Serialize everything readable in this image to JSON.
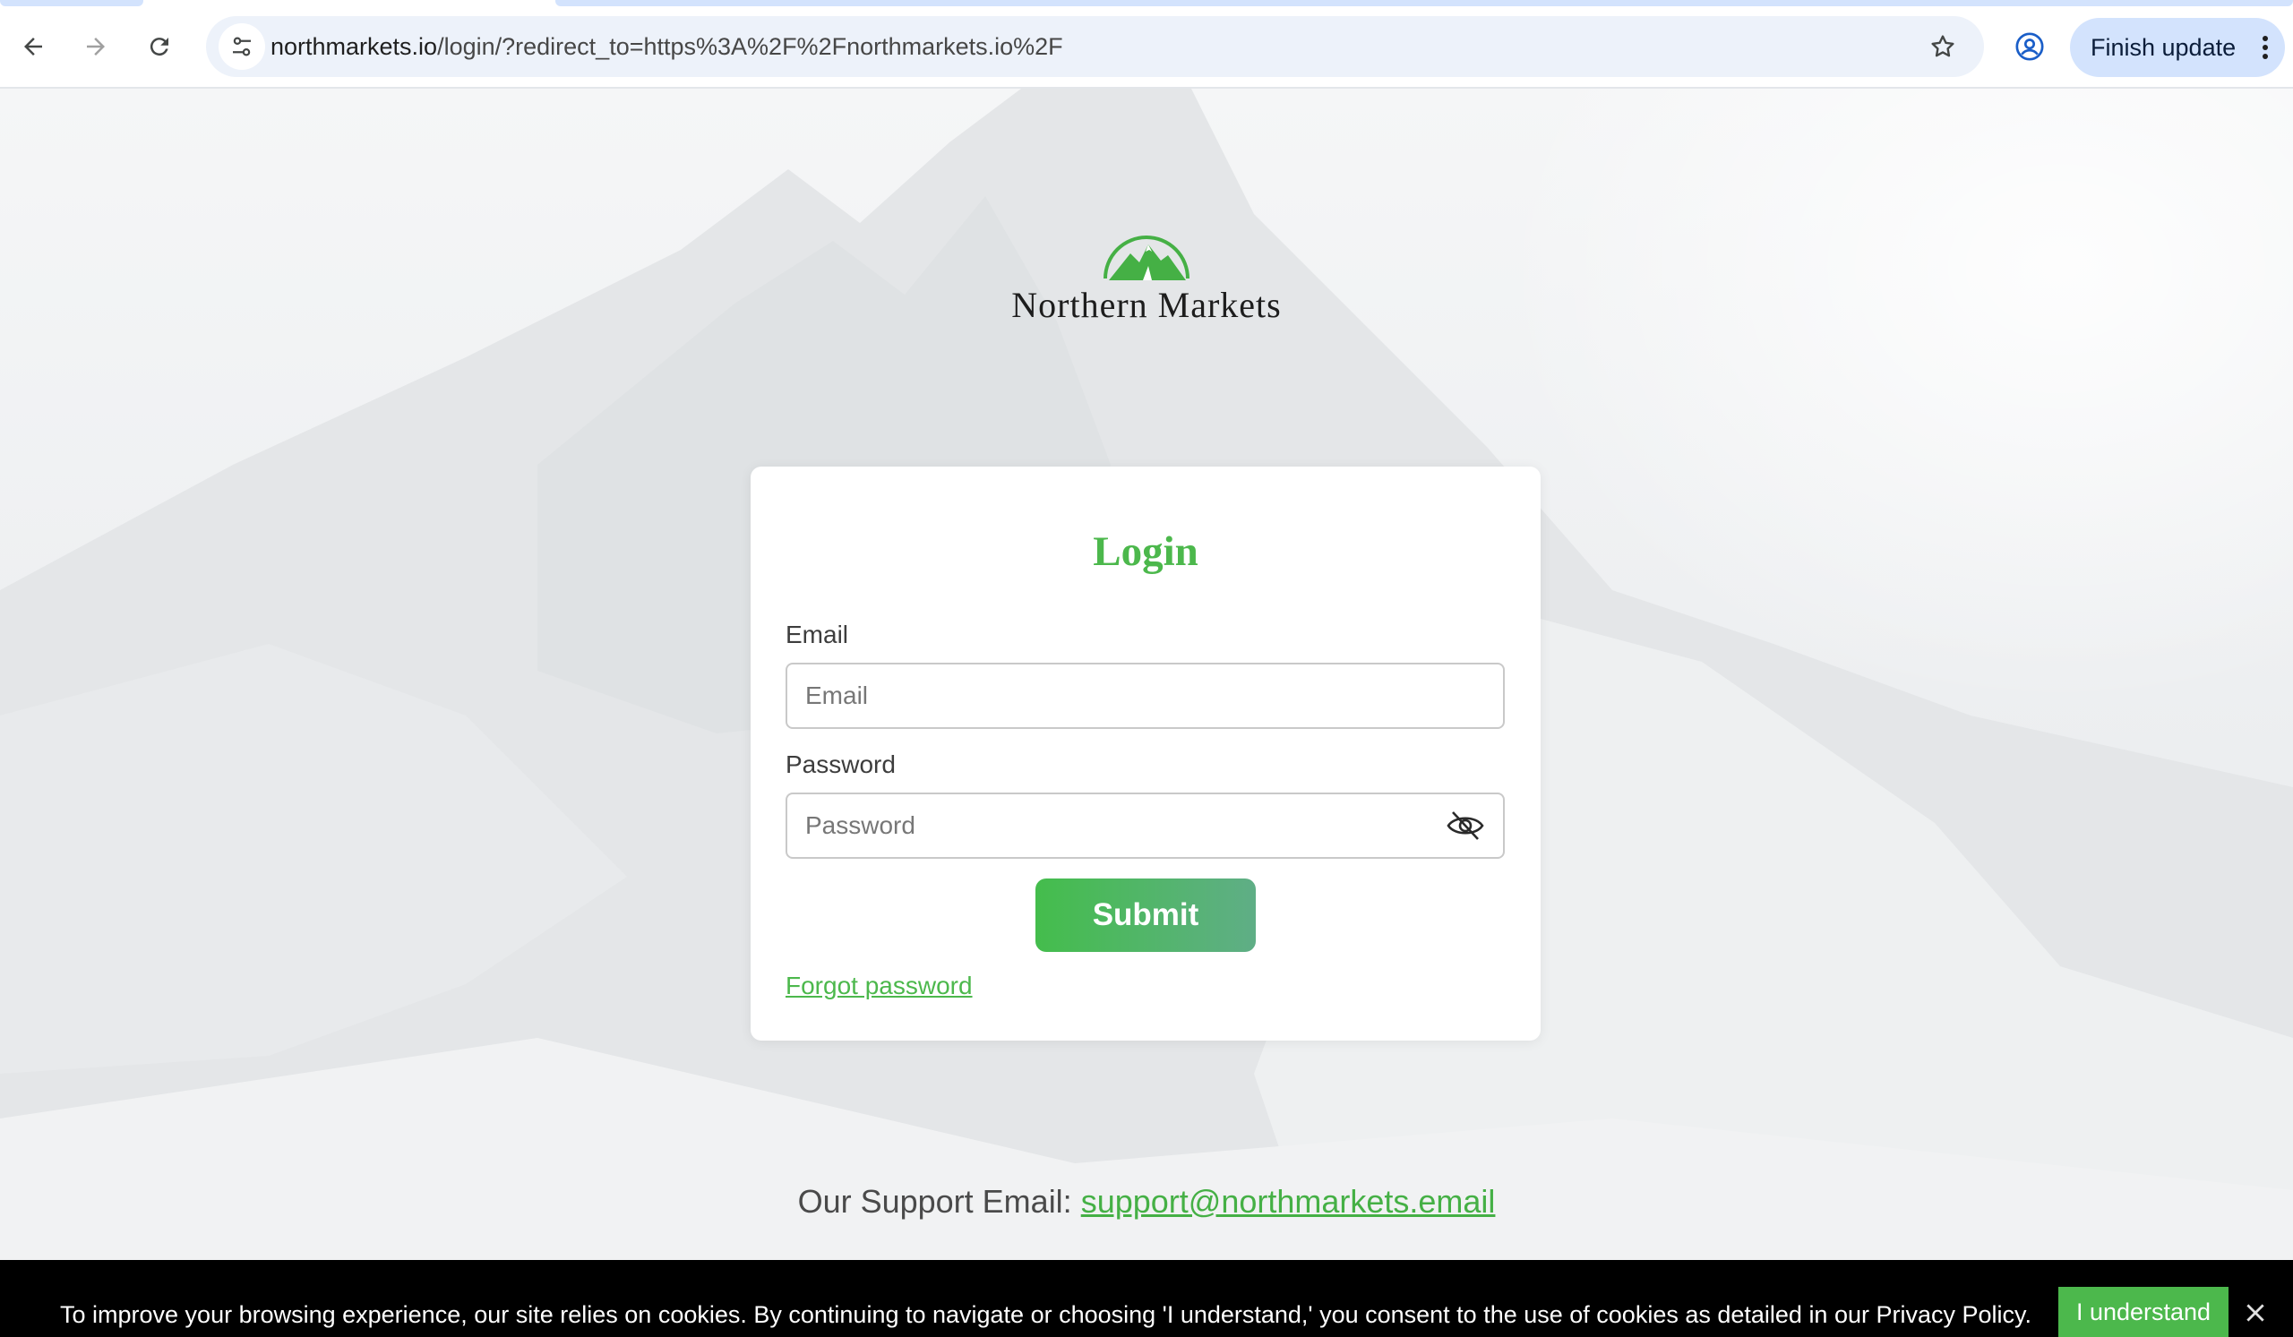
{
  "browser": {
    "url_domain": "northmarkets.io",
    "url_path": "/login/?redirect_to=https%3A%2F%2Fnorthmarkets.io%2F",
    "update_button_label": "Finish update",
    "icons": {
      "back": "arrow-left-icon",
      "forward": "arrow-right-icon",
      "reload": "reload-icon",
      "site_info": "tune-icon",
      "bookmark": "star-icon",
      "profile": "profile-icon",
      "menu": "kebab-menu-icon"
    }
  },
  "brand": {
    "name": "Northern Markets",
    "logo_icon": "mountain-logo-icon",
    "color": "#45b045"
  },
  "login": {
    "title": "Login",
    "email_label": "Email",
    "email_placeholder": "Email",
    "password_label": "Password",
    "password_placeholder": "Password",
    "password_toggle_icon": "eye-slash-icon",
    "submit_label": "Submit",
    "forgot_label": "Forgot password"
  },
  "support": {
    "prefix": "Our Support Email:",
    "email": "support@northmarkets.email"
  },
  "cookie_bar": {
    "message": "To improve your browsing experience, our site relies on cookies. By continuing to navigate or choosing 'I understand,' you consent to the use of cookies as detailed in our Privacy Policy.",
    "accept_label": "I understand",
    "close_icon": "close-icon",
    "accent_color": "#4cb84c"
  }
}
